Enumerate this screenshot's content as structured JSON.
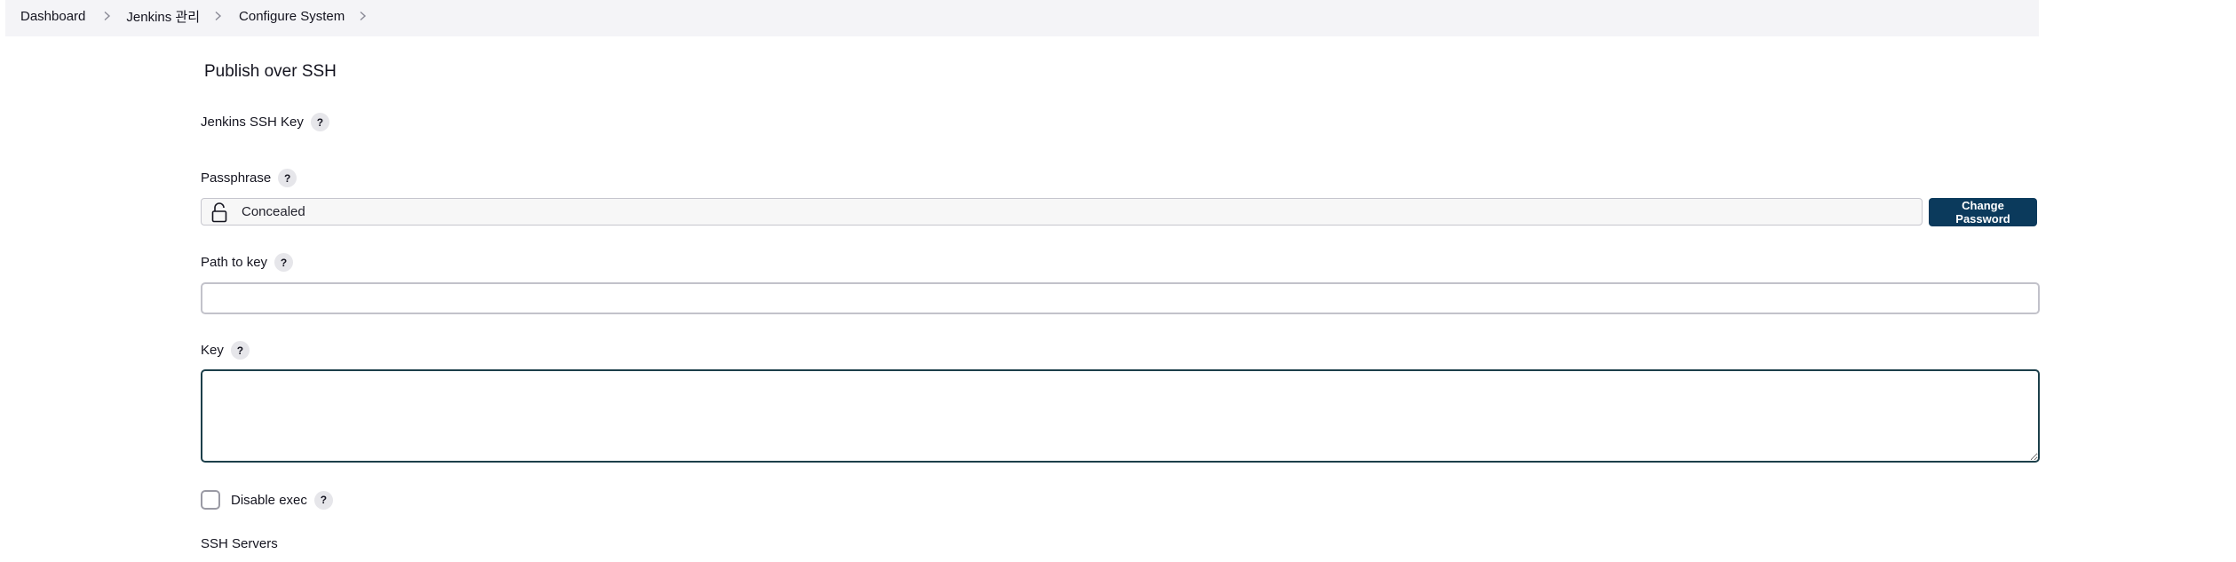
{
  "breadcrumb": {
    "items": [
      "Dashboard",
      "Jenkins 관리",
      "Configure System"
    ]
  },
  "section": {
    "title": "Publish over SSH"
  },
  "fields": {
    "jenkins_ssh_key": {
      "label": "Jenkins SSH Key",
      "help": "?"
    },
    "passphrase": {
      "label": "Passphrase",
      "help": "?",
      "value": "Concealed",
      "button": "Change Password"
    },
    "path_to_key": {
      "label": "Path to key",
      "help": "?",
      "value": ""
    },
    "key": {
      "label": "Key",
      "help": "?",
      "value": ""
    },
    "disable_exec": {
      "label": "Disable exec",
      "help": "?",
      "checked": false
    }
  },
  "subsection": {
    "title": "SSH Servers"
  },
  "icons": {
    "separator": "chevron-right-icon",
    "lock": "lock-icon",
    "help": "help-icon"
  },
  "colors": {
    "primary_button": "#0b3a5c",
    "breadcrumb_bg": "#f4f4f7",
    "textarea_border": "#1c3f4a"
  }
}
